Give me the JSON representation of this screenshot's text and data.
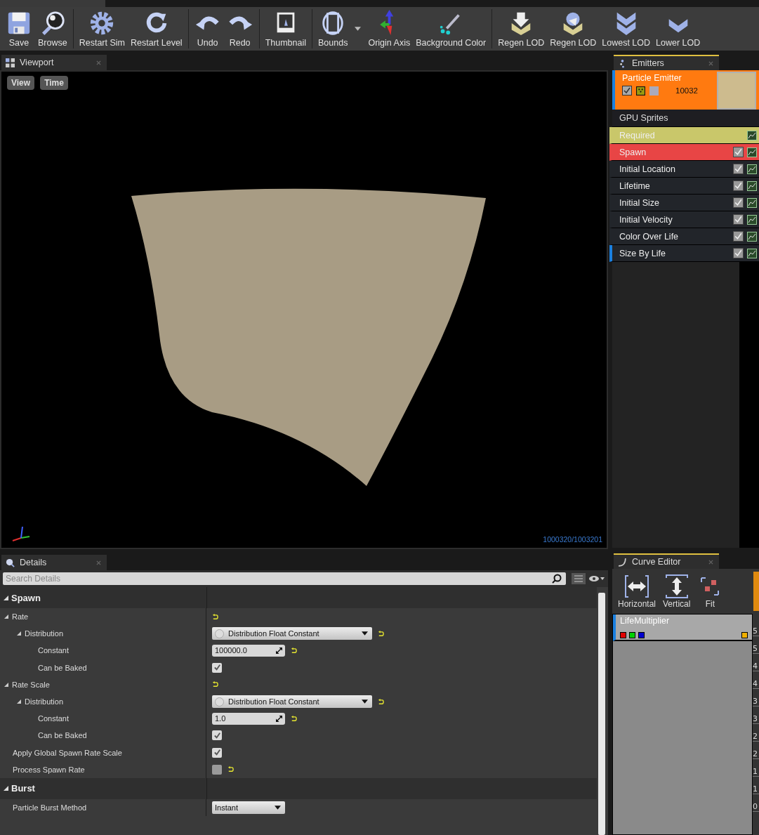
{
  "toolbar": {
    "groups": [
      [
        {
          "label": "Save",
          "kind": "save"
        },
        {
          "label": "Browse",
          "kind": "browse"
        }
      ],
      [
        {
          "label": "Restart Sim",
          "kind": "gear"
        },
        {
          "label": "Restart Level",
          "kind": "restart"
        }
      ],
      [
        {
          "label": "Undo",
          "kind": "undo"
        },
        {
          "label": "Redo",
          "kind": "redo"
        }
      ],
      [
        {
          "label": "Thumbnail",
          "kind": "thumbnail"
        }
      ],
      [
        {
          "label": "Bounds",
          "kind": "bounds"
        },
        {
          "kind": "dropdown"
        },
        {
          "label": "Origin Axis",
          "kind": "axis"
        },
        {
          "label": "Background Color",
          "kind": "picker"
        }
      ],
      [
        {
          "label": "Regen LOD",
          "kind": "lod-down"
        },
        {
          "label": "Regen LOD",
          "kind": "lod-regen"
        },
        {
          "label": "Lowest LOD",
          "kind": "lod-lowest"
        },
        {
          "label": "Lower LOD",
          "kind": "lod-lower"
        }
      ]
    ]
  },
  "viewport": {
    "tab": "Viewport",
    "buttons": [
      "View",
      "Time"
    ],
    "counter": "1000320/1003201"
  },
  "emitters": {
    "tab": "Emitters",
    "emitter": {
      "name": "Particle Emitter",
      "enabled": true,
      "count": "10032",
      "selected": true
    },
    "type_label": "GPU Sprites",
    "modules": [
      {
        "name": "Required",
        "kind": "required",
        "selected": false
      },
      {
        "name": "Spawn",
        "kind": "spawn",
        "checked": true,
        "selected": false
      },
      {
        "name": "Initial Location",
        "kind": "module",
        "checked": true,
        "selected": false
      },
      {
        "name": "Lifetime",
        "kind": "module",
        "checked": true,
        "selected": false
      },
      {
        "name": "Initial Size",
        "kind": "module",
        "checked": true,
        "selected": false
      },
      {
        "name": "Initial Velocity",
        "kind": "module",
        "checked": true,
        "selected": false
      },
      {
        "name": "Color Over Life",
        "kind": "module",
        "checked": true,
        "selected": false
      },
      {
        "name": "Size By Life",
        "kind": "module",
        "checked": true,
        "selected": true
      }
    ]
  },
  "details": {
    "tab": "Details",
    "search": {
      "placeholder": "Search Details"
    },
    "sections": [
      {
        "title": "Spawn",
        "rows": [
          {
            "label": "Rate",
            "kind": "none",
            "resettable": true,
            "children": [
              {
                "label": "Distribution",
                "kind": "dropdown",
                "value": "Distribution Float Constant",
                "resettable": true,
                "children": [
                  {
                    "label": "Constant",
                    "kind": "number",
                    "value": "100000.0",
                    "resettable": true
                  },
                  {
                    "label": "Can be Baked",
                    "kind": "checkbox",
                    "checked": true,
                    "resettable": false
                  }
                ]
              }
            ]
          },
          {
            "label": "Rate Scale",
            "kind": "none",
            "resettable": true,
            "children": [
              {
                "label": "Distribution",
                "kind": "dropdown",
                "value": "Distribution Float Constant",
                "resettable": true,
                "children": [
                  {
                    "label": "Constant",
                    "kind": "number",
                    "value": "1.0",
                    "resettable": true
                  },
                  {
                    "label": "Can be Baked",
                    "kind": "checkbox",
                    "checked": true,
                    "resettable": false
                  }
                ]
              }
            ]
          },
          {
            "label": "Apply Global Spawn Rate Scale",
            "kind": "checkbox",
            "checked": true,
            "resettable": false
          },
          {
            "label": "Process Spawn Rate",
            "kind": "checkbox",
            "checked": false,
            "resettable": true
          }
        ]
      },
      {
        "title": "Burst",
        "rows": [
          {
            "label": "Particle Burst Method",
            "kind": "select",
            "value": "Instant",
            "resettable": false
          }
        ]
      }
    ]
  },
  "curve_editor": {
    "tab": "Curve Editor",
    "buttons": [
      {
        "label": "Horizontal",
        "kind": "horizontal"
      },
      {
        "label": "Vertical",
        "kind": "vertical"
      },
      {
        "label": "Fit",
        "kind": "fit"
      }
    ],
    "curve": {
      "name": "LifeMultiplier",
      "channels": [
        {
          "color": "#e00000"
        },
        {
          "color": "#00d000"
        },
        {
          "color": "#0000d0"
        }
      ],
      "key_toggle": {
        "color": "#f0b000"
      }
    },
    "axis_labels": [
      "5",
      "5",
      "4",
      "4",
      "3",
      "3",
      "2",
      "2",
      "1",
      "1",
      "0"
    ]
  }
}
